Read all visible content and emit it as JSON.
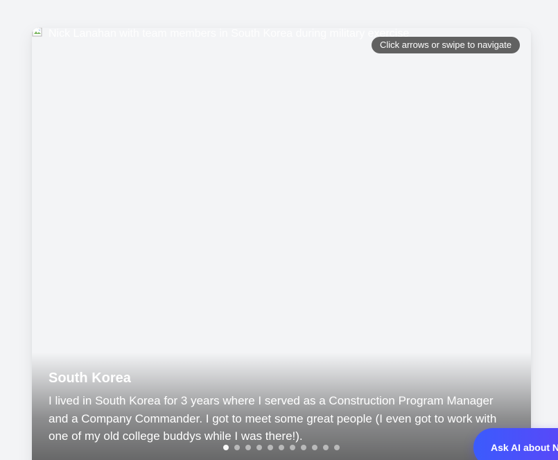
{
  "slide": {
    "image_alt": "Nick Lanahan with team members in South Korea during military exercise",
    "nav_hint": "Click arrows or swipe to navigate",
    "title": "South Korea",
    "description": "I lived in South Korea for 3 years where I served as a Construction Program Manager and a Company Commander. I got to meet some great people (I even got to work with one of my old college buddys while I was there!).",
    "dot_count": 11,
    "active_dot": 0
  },
  "ask_ai": {
    "label": "Ask AI about Nick"
  },
  "colors": {
    "background": "#f3f4f6",
    "accent_start": "#3b5bfd",
    "accent_end": "#6a3df5"
  }
}
